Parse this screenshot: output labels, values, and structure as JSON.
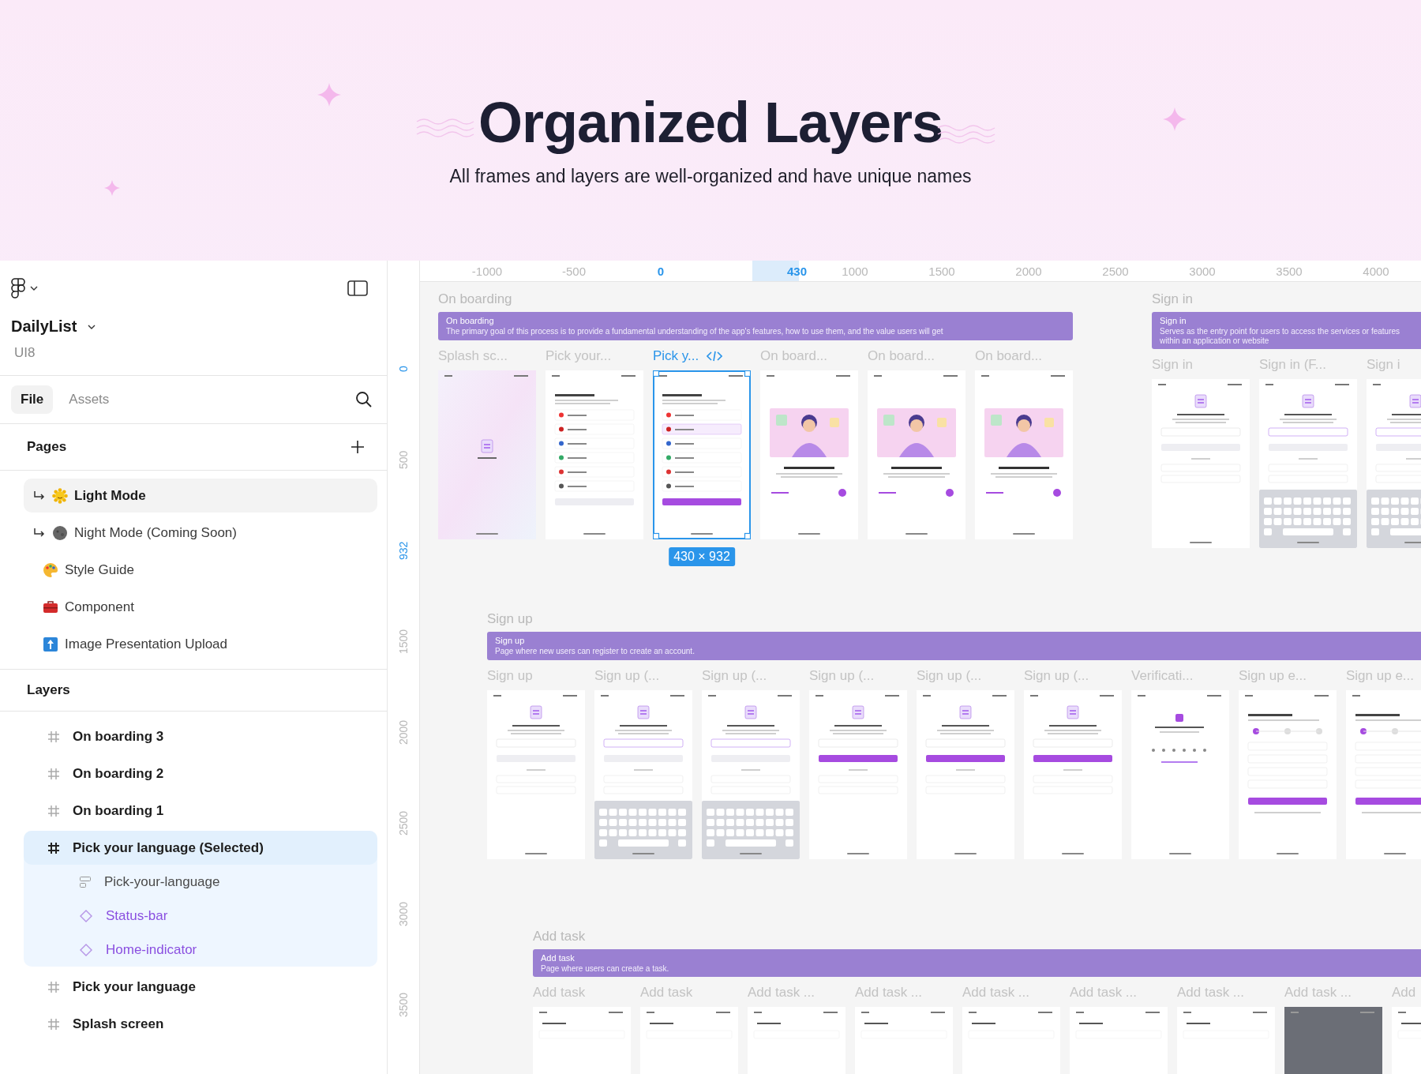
{
  "hero": {
    "title": "Organized Layers",
    "subtitle": "All frames and layers are well-organized and have unique names"
  },
  "sidebar": {
    "file_name": "DailyList",
    "team": "UI8",
    "tabs": [
      {
        "label": "File",
        "selected": true
      },
      {
        "label": "Assets",
        "selected": false
      }
    ],
    "pages_title": "Pages",
    "pages": [
      {
        "label": "Light Mode",
        "kind": "subpage",
        "selected": true
      },
      {
        "label": "Night Mode (Coming Soon)",
        "kind": "subpage",
        "selected": false
      },
      {
        "label": "Style Guide",
        "kind": "page",
        "selected": false
      },
      {
        "label": "Component",
        "kind": "page",
        "selected": false
      },
      {
        "label": "Image Presentation Upload",
        "kind": "page",
        "selected": false
      }
    ],
    "layers_title": "Layers",
    "layers": [
      {
        "label": "On boarding 3",
        "kind": "frame",
        "selected": false
      },
      {
        "label": "On boarding 2",
        "kind": "frame",
        "selected": false
      },
      {
        "label": "On boarding 1",
        "kind": "frame",
        "selected": false
      },
      {
        "label": "Pick your language (Selected)",
        "kind": "frame",
        "selected": true,
        "children": [
          {
            "label": "Pick-your-language",
            "kind": "autolayout",
            "selected": false
          },
          {
            "label": "Status-bar",
            "kind": "instance",
            "selected": false
          },
          {
            "label": "Home-indicator",
            "kind": "instance",
            "selected": false
          }
        ]
      },
      {
        "label": "Pick your language",
        "kind": "frame",
        "selected": false
      },
      {
        "label": "Splash screen",
        "kind": "frame",
        "selected": false
      }
    ]
  },
  "canvas": {
    "ruler_x": [
      {
        "label": "-1000",
        "selected": false
      },
      {
        "label": "-500",
        "selected": false
      },
      {
        "label": "0",
        "selected": true
      },
      {
        "label": "430",
        "selected": true
      },
      {
        "label": "1000",
        "selected": false
      },
      {
        "label": "1500",
        "selected": false
      },
      {
        "label": "2000",
        "selected": false
      },
      {
        "label": "2500",
        "selected": false
      },
      {
        "label": "3000",
        "selected": false
      },
      {
        "label": "3500",
        "selected": false
      },
      {
        "label": "4000",
        "selected": false
      }
    ],
    "ruler_y": [
      {
        "label": "0",
        "selected": true
      },
      {
        "label": "500",
        "selected": false
      },
      {
        "label": "932",
        "selected": true
      },
      {
        "label": "1500",
        "selected": false
      },
      {
        "label": "2000",
        "selected": false
      },
      {
        "label": "2500",
        "selected": false
      },
      {
        "label": "3000",
        "selected": false
      },
      {
        "label": "3500",
        "selected": false
      }
    ],
    "rows": [
      {
        "sections": [
          {
            "title": "On boarding",
            "banner_title": "On boarding",
            "banner_text": "The primary goal of this process is to provide a fundamental understanding of the app's features, how to use them, and the value users will get",
            "frames": [
              {
                "label": "Splash sc...",
                "kind": "splash",
                "selected": false
              },
              {
                "label": "Pick your...",
                "kind": "list",
                "selected": false
              },
              {
                "label": "Pick y...",
                "kind": "list-filled",
                "selected": true,
                "size": "430 × 932"
              },
              {
                "label": "On board...",
                "kind": "illustration",
                "selected": false
              },
              {
                "label": "On board...",
                "kind": "illustration",
                "selected": false
              },
              {
                "label": "On board...",
                "kind": "illustration",
                "selected": false
              }
            ]
          },
          {
            "title": "Sign in",
            "banner_title": "Sign in",
            "banner_text": "Serves as the entry point for users to access the services or features within an application or website",
            "frames": [
              {
                "label": "Sign in",
                "kind": "form",
                "selected": false
              },
              {
                "label": "Sign in (F...",
                "kind": "keyboard",
                "selected": false
              },
              {
                "label": "Sign i",
                "kind": "keyboard",
                "selected": false
              }
            ]
          }
        ]
      },
      {
        "sections": [
          {
            "title": "Sign up",
            "banner_title": "Sign up",
            "banner_text": "Page where new users can register to create an account.",
            "frames": [
              {
                "label": "Sign up",
                "kind": "form",
                "selected": false
              },
              {
                "label": "Sign up (...",
                "kind": "keyboard",
                "selected": false
              },
              {
                "label": "Sign up (...",
                "kind": "keyboard",
                "selected": false
              },
              {
                "label": "Sign up (...",
                "kind": "form-filled",
                "selected": false
              },
              {
                "label": "Sign up (...",
                "kind": "form-filled",
                "selected": false
              },
              {
                "label": "Sign up (...",
                "kind": "form-filled",
                "selected": false
              },
              {
                "label": "Verificati...",
                "kind": "code",
                "selected": false
              },
              {
                "label": "Sign up e...",
                "kind": "steps",
                "selected": false
              },
              {
                "label": "Sign up e...",
                "kind": "steps",
                "selected": false
              }
            ]
          }
        ]
      },
      {
        "sections": [
          {
            "title": "Add task",
            "banner_title": "Add task",
            "banner_text": "Page where users can create a task.",
            "frames": [
              {
                "label": "Add task",
                "kind": "task",
                "selected": false
              },
              {
                "label": "Add task",
                "kind": "task",
                "selected": false
              },
              {
                "label": "Add task ...",
                "kind": "task",
                "selected": false
              },
              {
                "label": "Add task ...",
                "kind": "task",
                "selected": false
              },
              {
                "label": "Add task ...",
                "kind": "task",
                "selected": false
              },
              {
                "label": "Add task ...",
                "kind": "task",
                "selected": false
              },
              {
                "label": "Add task ...",
                "kind": "task",
                "selected": false
              },
              {
                "label": "Add task ...",
                "kind": "dark",
                "selected": false
              },
              {
                "label": "Add",
                "kind": "task",
                "selected": false
              }
            ]
          }
        ]
      }
    ]
  }
}
